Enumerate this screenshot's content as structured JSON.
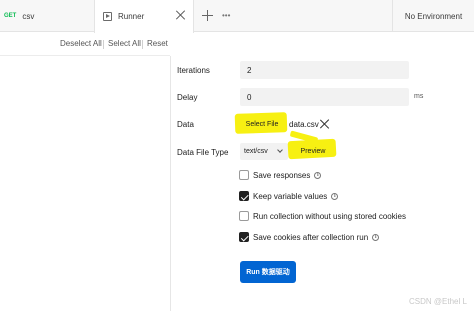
{
  "tabs": [
    {
      "method": "GET",
      "title": "csv"
    },
    {
      "title": "Runner"
    }
  ],
  "environment": {
    "label": "No Environment"
  },
  "toolbar": {
    "deselect_all": "Deselect All",
    "select_all": "Select All",
    "reset": "Reset"
  },
  "form": {
    "iterations": {
      "label": "Iterations",
      "value": "2"
    },
    "delay": {
      "label": "Delay",
      "value": "0",
      "unit": "ms"
    },
    "data": {
      "label": "Data",
      "button": "Select File",
      "file": "data.csv"
    },
    "data_file_type": {
      "label": "Data File Type",
      "value": "text/csv",
      "preview": "Preview"
    },
    "options": [
      {
        "label": "Save responses",
        "checked": false,
        "info": true
      },
      {
        "label": "Keep variable values",
        "checked": true,
        "info": true
      },
      {
        "label": "Run collection without using stored cookies",
        "checked": false,
        "info": false
      },
      {
        "label": "Save cookies after collection run",
        "checked": true,
        "info": true
      }
    ],
    "run_button": "Run 数据驱动"
  },
  "watermark": "CSDN @Ethel L",
  "colors": {
    "accent": "#0265d2",
    "highlight": "#f7f012",
    "method_get": "#0cbb52"
  }
}
